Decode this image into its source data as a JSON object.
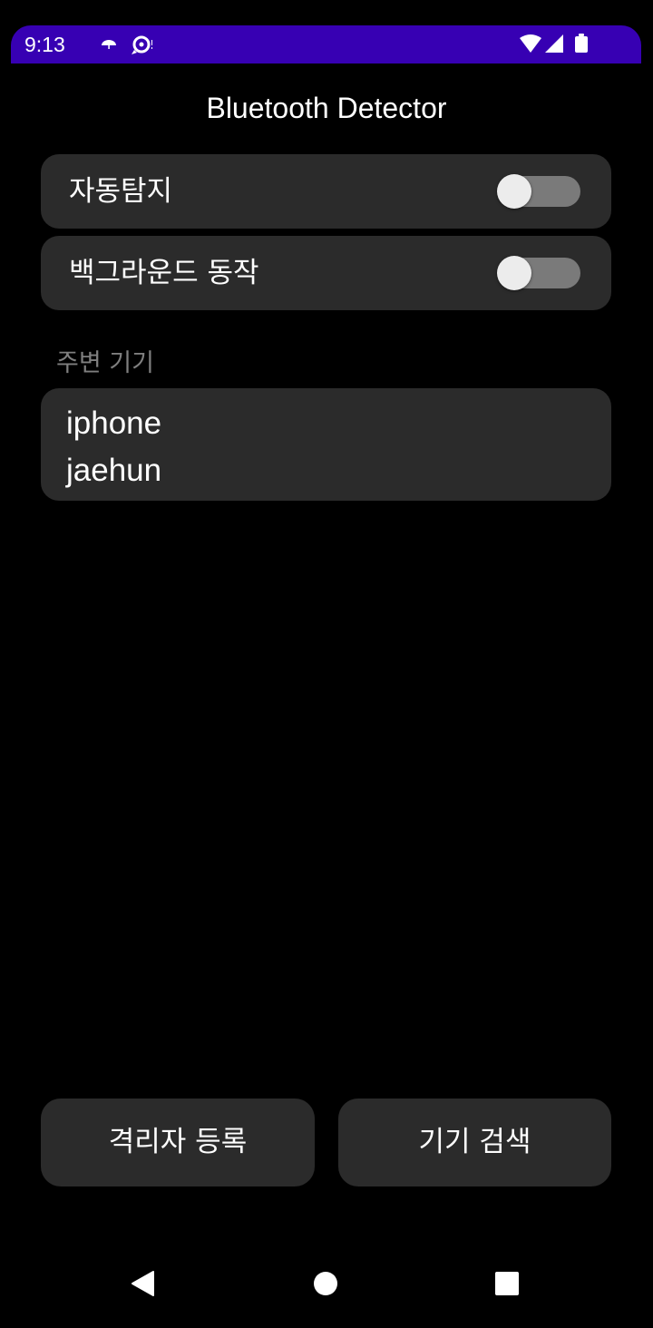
{
  "status_bar": {
    "time": "9:13",
    "color": "#3700b3",
    "left_icons": [
      "umbrella-icon",
      "notification-icon"
    ],
    "right_icons": [
      "wifi-icon",
      "cell-signal-icon",
      "battery-icon"
    ]
  },
  "app": {
    "title": "Bluetooth Detector"
  },
  "settings": {
    "auto_detect": {
      "label": "자동탐지",
      "enabled": false
    },
    "background": {
      "label": "백그라운드 동작",
      "enabled": false
    }
  },
  "devices": {
    "section_label": "주변 기기",
    "items": [
      "iphone",
      "jaehun"
    ]
  },
  "actions": {
    "register_label": "격리자 등록",
    "scan_label": "기기 검색"
  },
  "nav": {
    "icons": [
      "back-icon",
      "home-icon",
      "recents-icon"
    ]
  }
}
